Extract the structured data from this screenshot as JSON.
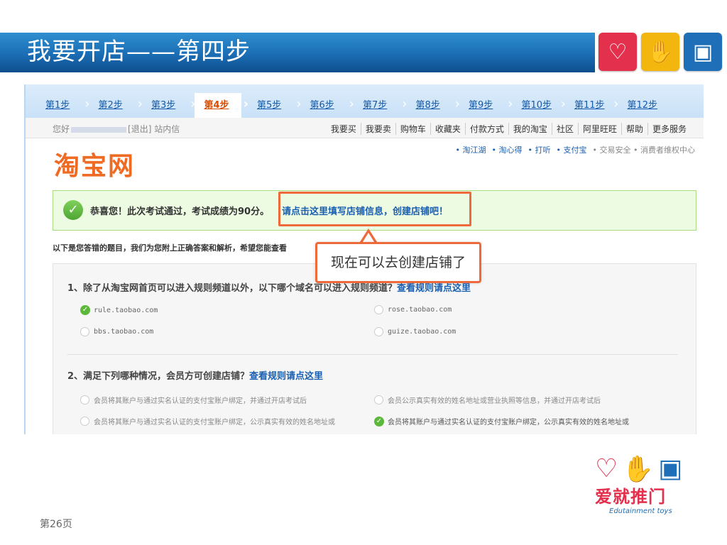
{
  "slide": {
    "title": "我要开店——第四步",
    "page_label": "第26页"
  },
  "tiles": [
    {
      "icon": "heart-icon",
      "glyph": "♡"
    },
    {
      "icon": "hand-icon",
      "glyph": "✋"
    },
    {
      "icon": "square-icon",
      "glyph": "▣"
    }
  ],
  "steps": [
    "第1步",
    "第2步",
    "第3步",
    "第4步",
    "第5步",
    "第6步",
    "第7步",
    "第8步",
    "第9步",
    "第10步",
    "第11步",
    "第12步"
  ],
  "active_step": 3,
  "topbar": {
    "greeting_prefix": "您好",
    "greeting_suffix": "[退出] 站内信",
    "nav": [
      "我要买",
      "我要卖",
      "购物车",
      "收藏夹",
      "付款方式",
      "我的淘宝",
      "社区",
      "阿里旺旺",
      "帮助",
      "更多服务"
    ]
  },
  "site": {
    "logo": "淘宝网",
    "links": [
      "• 淘江湖",
      "• 淘心得",
      "• 打听",
      "• 支付宝"
    ],
    "links_gray": "• 交易安全 • 消费者维权中心"
  },
  "pass": {
    "text": "恭喜您！此次考试通过，考试成绩为90分。",
    "link": "请点击这里填写店铺信息，创建店铺吧！"
  },
  "wrong_intro": "以下是您答错的题目，我们为您附上正确答案和解析，希望您能查看",
  "callout": "现在可以去创建店铺了",
  "questions": [
    {
      "text": "1、除了从淘宝网首页可以进入规则频道以外，以下哪个域名可以进入规则频道？",
      "link": "查看规则请点这里",
      "options": [
        "rule.taobao.com",
        "rose.taobao.com",
        "bbs.taobao.com",
        "guize.taobao.com"
      ]
    },
    {
      "text": "2、满足下列哪种情况，会员方可创建店铺？",
      "link": "查看规则请点这里",
      "options": [
        "会员将其账户与通过实名认证的支付宝账户绑定，并通过开店考试后",
        "会员公示真实有效的姓名地址或营业执照等信息，并通过开店考试后",
        "会员将其账户与通过实名认证的支付宝账户绑定，公示真实有效的姓名地址或",
        "会员将其账户与通过实名认证的支付宝账户绑定，公示真实有效的姓名地址或"
      ]
    }
  ],
  "brand": {
    "name": "爱就推门",
    "tagline": "Edutainment toys"
  }
}
